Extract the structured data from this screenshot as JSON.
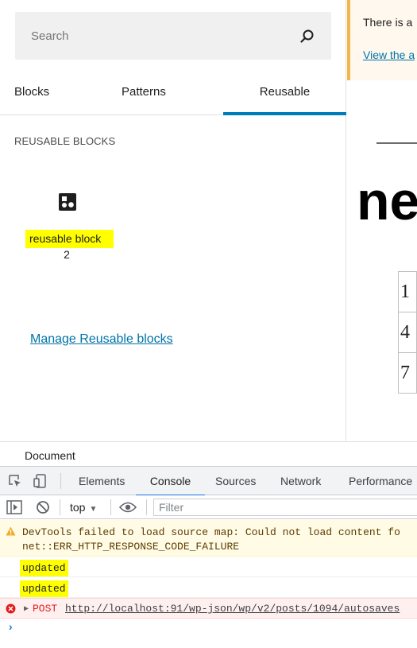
{
  "inserter": {
    "search_placeholder": "Search",
    "tabs": [
      "Blocks",
      "Patterns",
      "Reusable"
    ],
    "active_tab": "Reusable",
    "section_title": "REUSABLE BLOCKS",
    "block": {
      "title": "reusable block",
      "count": "2"
    },
    "manage_link": "Manage Reusable blocks"
  },
  "notice": {
    "text": "There is a",
    "link": "View the a"
  },
  "canvas": {
    "heading": "ne",
    "table_cells": [
      "1",
      "4",
      "7"
    ]
  },
  "document_bar": {
    "label": "Document"
  },
  "devtools": {
    "tabs": [
      "Elements",
      "Console",
      "Sources",
      "Network",
      "Performance"
    ],
    "active_tab": "Console",
    "context": "top",
    "filter_placeholder": "Filter",
    "messages": {
      "warning_line1": "DevTools failed to load source map: Could not load content fo",
      "warning_line2": "net::ERR_HTTP_RESPONSE_CODE_FAILURE",
      "log1": "updated",
      "log2": "updated",
      "error_method": "POST",
      "error_url": "http://localhost:91/wp-json/wp/v2/posts/1094/autosaves"
    },
    "prompt": "›"
  },
  "colors": {
    "accent": "#007cba",
    "highlight": "#ffff00",
    "notice_border": "#f0b849",
    "devtools_accent": "#1a73e8",
    "error": "#e41a1a"
  },
  "icons": [
    "search-icon",
    "reusable-block-icon",
    "inspect-element-icon",
    "device-toolbar-icon",
    "sidebar-toggle-icon",
    "clear-console-icon",
    "eye-icon",
    "warning-icon",
    "error-icon",
    "expand-arrow-icon",
    "prompt-icon"
  ]
}
